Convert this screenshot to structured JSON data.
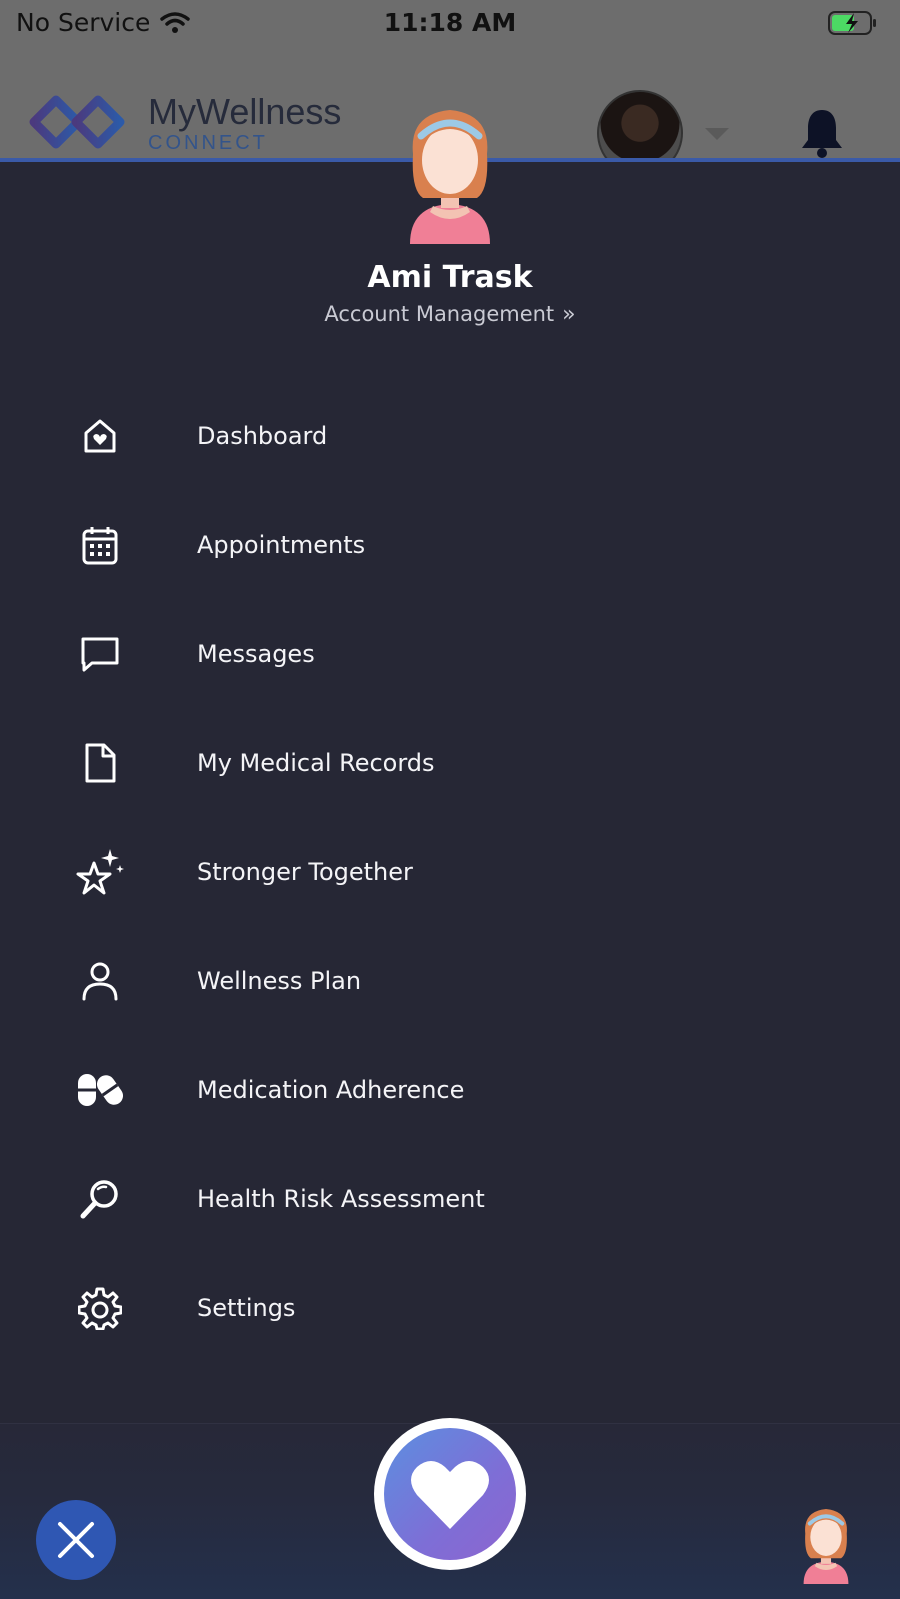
{
  "status_bar": {
    "carrier": "No Service",
    "time": "11:18 AM"
  },
  "header": {
    "logo_title": "MyWellness",
    "logo_subtitle": "CONNECT"
  },
  "profile": {
    "name": "Ami Trask",
    "account_link": "Account Management"
  },
  "menu": {
    "items": [
      {
        "label": "Dashboard",
        "icon": "home-heart-icon"
      },
      {
        "label": "Appointments",
        "icon": "calendar-icon"
      },
      {
        "label": "Messages",
        "icon": "chat-bubble-icon"
      },
      {
        "label": "My Medical Records",
        "icon": "document-icon"
      },
      {
        "label": "Stronger Together",
        "icon": "stars-icon"
      },
      {
        "label": "Wellness Plan",
        "icon": "person-icon"
      },
      {
        "label": "Medication Adherence",
        "icon": "pills-icon"
      },
      {
        "label": "Health Risk Assessment",
        "icon": "magnifier-icon"
      },
      {
        "label": "Settings",
        "icon": "gear-icon"
      }
    ]
  },
  "colors": {
    "drawer_bg": "#262735",
    "header_dim": "#6d6d6d",
    "accent_blue": "#2f57b3",
    "heart_gradient_start": "#5c8fe0",
    "heart_gradient_end": "#8d65cf"
  }
}
